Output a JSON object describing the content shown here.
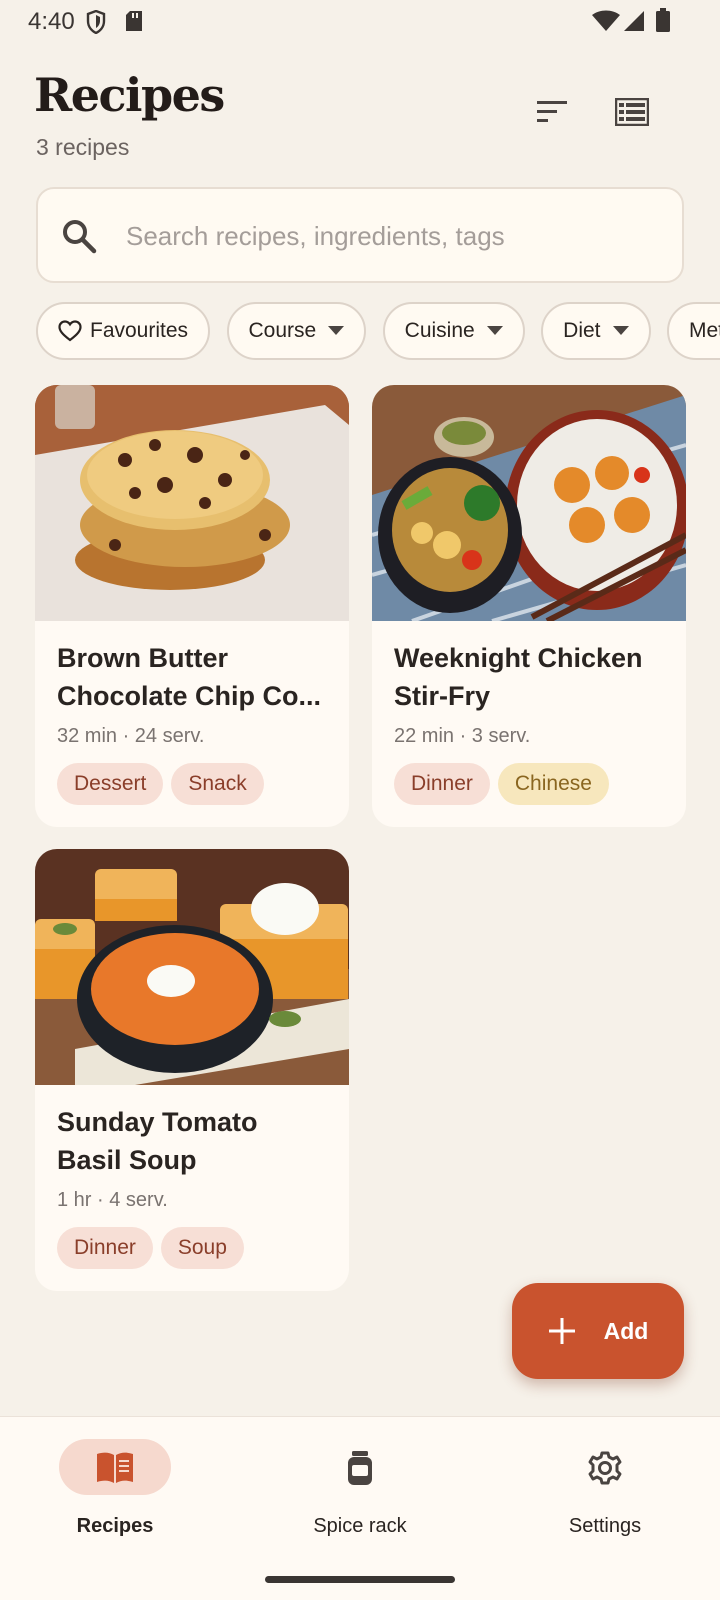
{
  "status": {
    "time": "4:40"
  },
  "header": {
    "title": "Recipes",
    "count": "3 recipes"
  },
  "search": {
    "placeholder": "Search recipes, ingredients, tags",
    "value": ""
  },
  "filters": [
    {
      "label": "Favourites",
      "icon": "heart-icon"
    },
    {
      "label": "Course",
      "icon": "caret-down-icon"
    },
    {
      "label": "Cuisine",
      "icon": "caret-down-icon"
    },
    {
      "label": "Diet",
      "icon": "caret-down-icon"
    },
    {
      "label": "Method",
      "icon": "caret-down-icon"
    }
  ],
  "recipes": [
    {
      "title_line1": "Brown Butter",
      "title_line2": "Chocolate Chip Co...",
      "meta": "32 min · 24 serv.",
      "tags": [
        {
          "label": "Dessert"
        },
        {
          "label": "Snack"
        }
      ],
      "image": "chocolate-chip-cookies"
    },
    {
      "title_line1": "Weeknight Chicken",
      "title_line2": "Stir-Fry",
      "meta": "22 min · 3 serv.",
      "tags": [
        {
          "label": "Dinner"
        },
        {
          "label": "Chinese"
        }
      ],
      "image": "chicken-stir-fry"
    },
    {
      "title_line1": "Sunday Tomato",
      "title_line2": "Basil Soup",
      "meta": "1 hr · 4 serv.",
      "tags": [
        {
          "label": "Dinner"
        },
        {
          "label": "Soup"
        }
      ],
      "image": "tomato-soup"
    }
  ],
  "fab": {
    "label": "Add",
    "icon": "plus-icon"
  },
  "nav": [
    {
      "label": "Recipes",
      "icon": "book-icon",
      "active": true
    },
    {
      "label": "Spice rack",
      "icon": "jar-icon",
      "active": false
    },
    {
      "label": "Settings",
      "icon": "gear-icon",
      "active": false
    }
  ],
  "colors": {
    "background": "#f6f1e9",
    "accent": "#c9532e",
    "tag_red_bg": "#f7dfd6",
    "tag_yellow_bg": "#f7e7bd",
    "nav_active_pill": "#f6d9ce"
  }
}
